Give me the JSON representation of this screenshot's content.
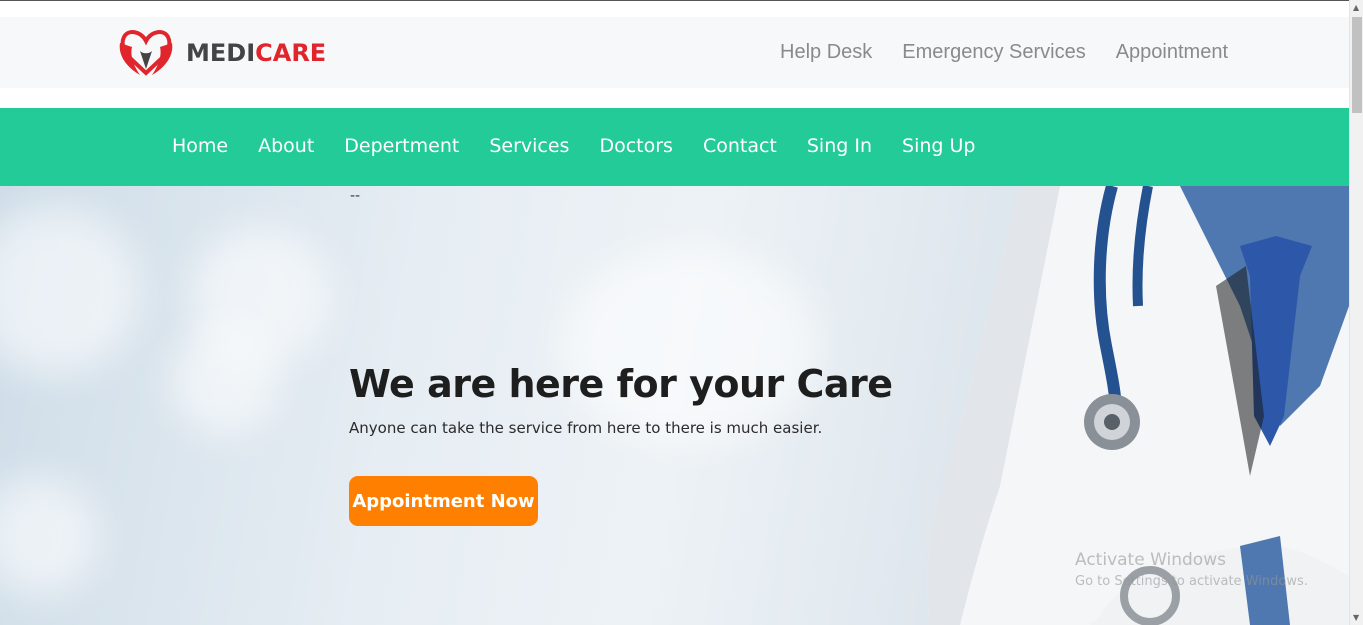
{
  "brand": {
    "part1": "MEDI",
    "part2": "CARE",
    "accent": "#e0262c",
    "icon": "heart-hands-icon"
  },
  "top_links": [
    "Help Desk",
    "Emergency Services",
    "Appointment"
  ],
  "nav": [
    "Home",
    "About",
    "Depertment",
    "Services",
    "Doctors",
    "Contact",
    "Sing In",
    "Sing Up"
  ],
  "hero": {
    "marker": "--",
    "title": "We are here for your Care",
    "subtitle": "Anyone can take the service from here to there is much easier.",
    "cta": "Appointment Now"
  },
  "watermark": {
    "line1": "Activate Windows",
    "line2": "Go to Settings to activate Windows."
  },
  "colors": {
    "nav_bg": "#22cb98",
    "cta_bg": "#ff8000",
    "header_bg": "#f7f8fa"
  },
  "scrollbar": {
    "up": "▲",
    "down": "▼"
  }
}
